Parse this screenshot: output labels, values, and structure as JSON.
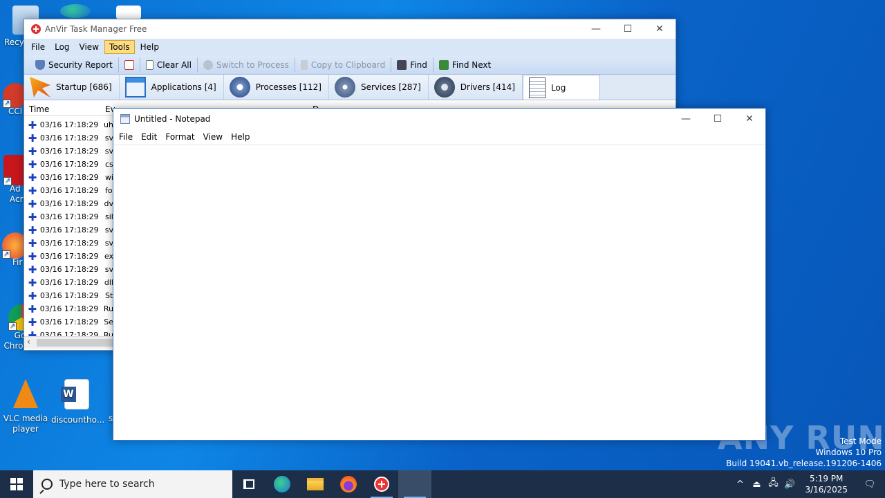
{
  "desktop": {
    "icons": [
      {
        "label": "Recy"
      },
      {
        "label": "CCl"
      },
      {
        "label": "Ad Acr"
      },
      {
        "label": "Fir"
      },
      {
        "label": "Go Chrome"
      },
      {
        "label": "VLC media player"
      },
      {
        "label": "discountho..."
      },
      {
        "label": "s"
      }
    ],
    "watermark": {
      "line1": "Test Mode",
      "line2": "Windows 10 Pro",
      "line3": "Build 19041.vb_release.191206-1406"
    },
    "brand": "ANY RUN"
  },
  "anvir": {
    "title": "AnVir Task Manager Free",
    "menu": [
      "File",
      "Log",
      "View",
      "Tools",
      "Help"
    ],
    "active_menu": "Tools",
    "toolbar": {
      "security_report": "Security Report",
      "clear_all": "Clear All",
      "switch_to_process": "Switch to Process",
      "copy_to_clipboard": "Copy to Clipboard",
      "find": "Find",
      "find_next": "Find Next"
    },
    "tabs": [
      {
        "label": "Startup [686]"
      },
      {
        "label": "Applications [4]"
      },
      {
        "label": "Processes [112]"
      },
      {
        "label": "Services [287]"
      },
      {
        "label": "Drivers [414]"
      },
      {
        "label": "Log"
      }
    ],
    "columns": {
      "time": "Time",
      "event": "Ev",
      "details": "D"
    },
    "rows": [
      {
        "time": "03/16 17:18:29",
        "event": "uh"
      },
      {
        "time": "03/16 17:18:29",
        "event": "sv"
      },
      {
        "time": "03/16 17:18:29",
        "event": "sv"
      },
      {
        "time": "03/16 17:18:29",
        "event": "cs"
      },
      {
        "time": "03/16 17:18:29",
        "event": "wi"
      },
      {
        "time": "03/16 17:18:29",
        "event": "fo"
      },
      {
        "time": "03/16 17:18:29",
        "event": "dv"
      },
      {
        "time": "03/16 17:18:29",
        "event": "sil"
      },
      {
        "time": "03/16 17:18:29",
        "event": "sv"
      },
      {
        "time": "03/16 17:18:29",
        "event": "sv"
      },
      {
        "time": "03/16 17:18:29",
        "event": "ex"
      },
      {
        "time": "03/16 17:18:29",
        "event": "sv"
      },
      {
        "time": "03/16 17:18:29",
        "event": "dll"
      },
      {
        "time": "03/16 17:18:29",
        "event": "St"
      },
      {
        "time": "03/16 17:18:29",
        "event": "Ru"
      },
      {
        "time": "03/16 17:18:29",
        "event": "Se"
      },
      {
        "time": "03/16 17:18:29",
        "event": "Ru"
      }
    ]
  },
  "notepad": {
    "title": "Untitled - Notepad",
    "menu": [
      "File",
      "Edit",
      "Format",
      "View",
      "Help"
    ],
    "content": ""
  },
  "taskbar": {
    "search_placeholder": "Type here to search",
    "time": "5:19 PM",
    "date": "3/16/2025"
  }
}
